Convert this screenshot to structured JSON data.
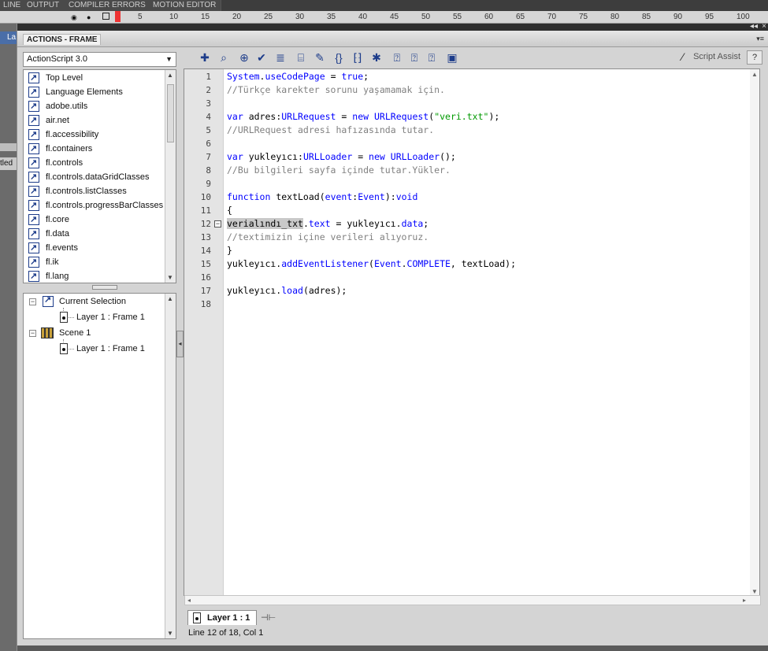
{
  "background": {
    "tabs": [
      "LINE",
      "OUTPUT",
      "COMPILER ERRORS",
      "MOTION EDITOR"
    ],
    "timeline_ticks": [
      "5",
      "10",
      "15",
      "20",
      "25",
      "30",
      "35",
      "40",
      "45",
      "50",
      "55",
      "60",
      "65",
      "70",
      "75",
      "80",
      "85",
      "90",
      "95",
      "100"
    ],
    "layer_label": "La",
    "doc_tab_fragment": "tled"
  },
  "panel": {
    "title": "ACTIONS - FRAME",
    "menu_glyph": "▾≡",
    "collapse_glyph": "◂◂",
    "close_glyph": "×"
  },
  "left": {
    "version_select": "ActionScript 3.0",
    "toolbox_items": [
      "Top Level",
      "Language Elements",
      "adobe.utils",
      "air.net",
      "fl.accessibility",
      "fl.containers",
      "fl.controls",
      "fl.controls.dataGridClasses",
      "fl.controls.listClasses",
      "fl.controls.progressBarClasses",
      "fl.core",
      "fl.data",
      "fl.events",
      "fl.ik",
      "fl.lang"
    ],
    "navigator": {
      "current_selection": "Current Selection",
      "current_frame": "Layer 1 : Frame 1",
      "scene": "Scene 1",
      "scene_frame": "Layer 1 : Frame 1"
    }
  },
  "toolbar": {
    "icons": [
      "add-item-icon",
      "find-icon",
      "target-path-icon",
      "check-syntax-icon",
      "auto-format-icon",
      "code-hint-icon",
      "debug-options-icon",
      "collapse-between-braces-icon",
      "collapse-selection-icon",
      "expand-all-icon",
      "apply-block-comment-icon",
      "apply-line-comment-icon",
      "remove-comment-icon",
      "show-hide-toolbox-icon"
    ],
    "script_assist": "Script Assist"
  },
  "code": {
    "line_numbers": [
      "1",
      "2",
      "3",
      "4",
      "5",
      "6",
      "7",
      "8",
      "9",
      "10",
      "11",
      "12",
      "13",
      "14",
      "15",
      "16",
      "17",
      "18"
    ],
    "lines": [
      "System.useCodePage = true;",
      "//Türkçe karekter sorunu yaşamamak için.",
      "",
      "var adres:URLRequest = new URLRequest(\"veri.txt\");",
      "//URLRequest adresi hafızasında tutar.",
      "",
      "var yukleyıcı:URLLoader = new URLLoader();",
      "//Bu bilgileri sayfa içinde tutar.Yükler.",
      "",
      "function textLoad(event:Event):void",
      "{",
      "verialındı_txt.text = yukleyıcı.data;",
      "//textimizin içine verileri alıyoruz.",
      "}",
      "yukleyıcı.addEventListener(Event.COMPLETE, textLoad);",
      "",
      "yukleyıcı.load(adres);",
      ""
    ],
    "fold_marker_line": "12",
    "selected_token": "verialındı_txt"
  },
  "bottom": {
    "script_tab": "Layer 1 : 1",
    "status": "Line 12 of 18, Col 1"
  },
  "colors": {
    "keyword": "#0000ff",
    "comment": "#808080",
    "string": "#009900",
    "selection": "#c9c9c9"
  }
}
